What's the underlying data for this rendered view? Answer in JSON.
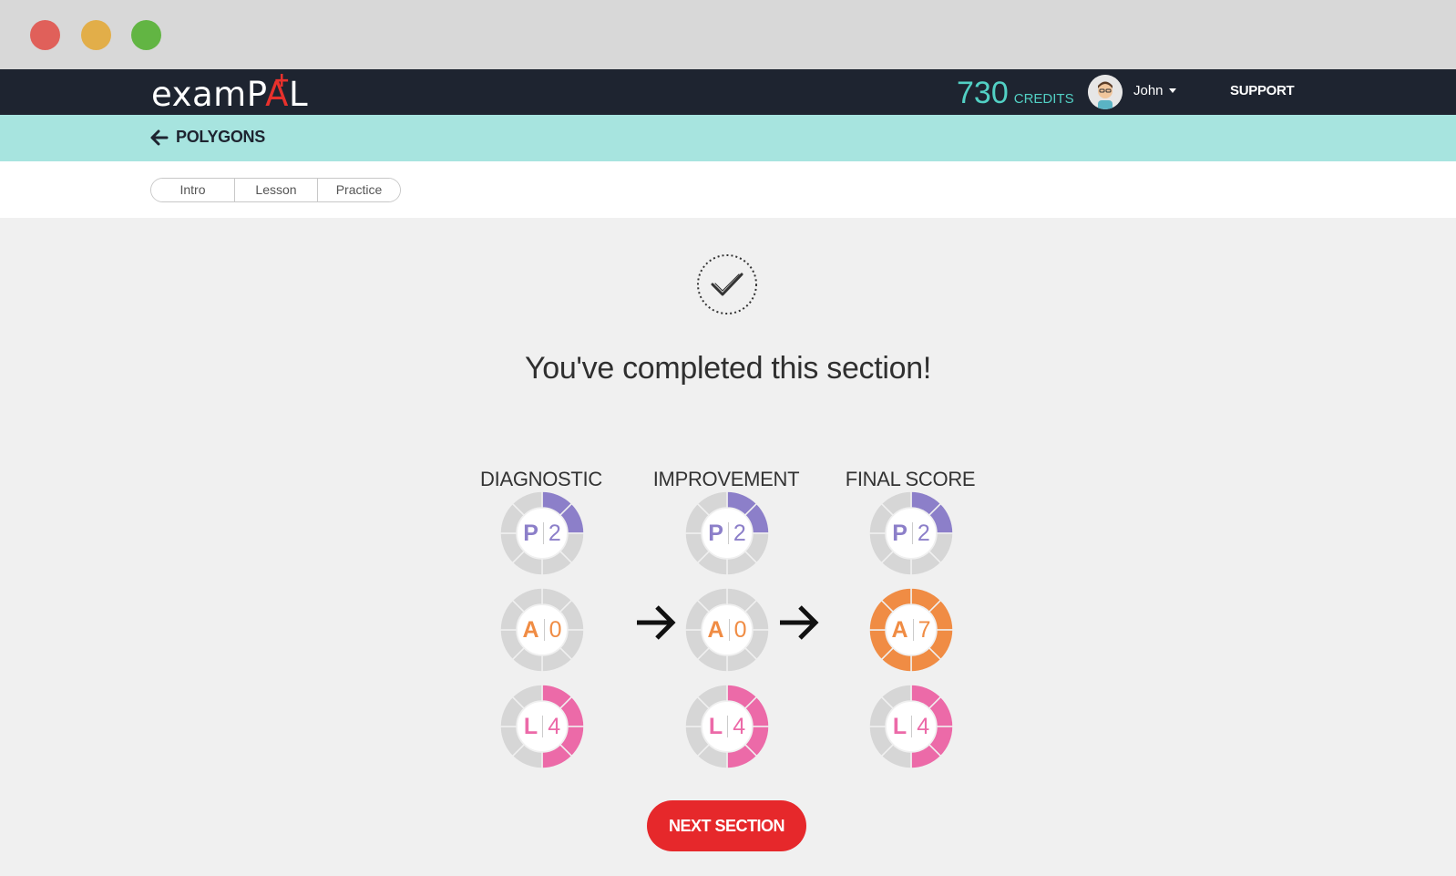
{
  "window": {
    "controls": [
      "close",
      "minimize",
      "maximize"
    ]
  },
  "nav": {
    "logo_text_1": "examP",
    "logo_text_2": "A",
    "logo_text_3": "L",
    "logo_plus": "+",
    "credits_value": "730",
    "credits_label": "CREDITS",
    "user_name": "John",
    "support_label": "SUPPORT"
  },
  "subnav": {
    "back_label": "POLYGONS"
  },
  "tabs": [
    {
      "label": "Intro"
    },
    {
      "label": "Lesson"
    },
    {
      "label": "Practice"
    }
  ],
  "main": {
    "headline": "You've completed this section!",
    "columns": [
      {
        "title": "DIAGNOSTIC"
      },
      {
        "title": "IMPROVEMENT"
      },
      {
        "title": "FINAL SCORE"
      }
    ],
    "next_button": "NEXT SECTION"
  },
  "scores": [
    [
      {
        "letter": "P",
        "value": "2",
        "filled": 2,
        "color": "#8c7fc9"
      },
      {
        "letter": "A",
        "value": "0",
        "filled": 0,
        "color": "#f08c44"
      },
      {
        "letter": "L",
        "value": "4",
        "filled": 4,
        "color": "#ec6aa8"
      }
    ],
    [
      {
        "letter": "P",
        "value": "2",
        "filled": 2,
        "color": "#8c7fc9"
      },
      {
        "letter": "A",
        "value": "0",
        "filled": 0,
        "color": "#f08c44"
      },
      {
        "letter": "L",
        "value": "4",
        "filled": 4,
        "color": "#ec6aa8"
      }
    ],
    [
      {
        "letter": "P",
        "value": "2",
        "filled": 2,
        "color": "#8c7fc9"
      },
      {
        "letter": "A",
        "value": "7",
        "filled": 8,
        "color": "#f08c44"
      },
      {
        "letter": "L",
        "value": "4",
        "filled": 4,
        "color": "#ec6aa8"
      }
    ]
  ],
  "colors": {
    "nav_bg": "#1e2430",
    "subnav_bg": "#a7e4df",
    "accent_teal": "#52d0c4",
    "button_red": "#e6282b",
    "ring_empty": "#d6d6d6"
  }
}
